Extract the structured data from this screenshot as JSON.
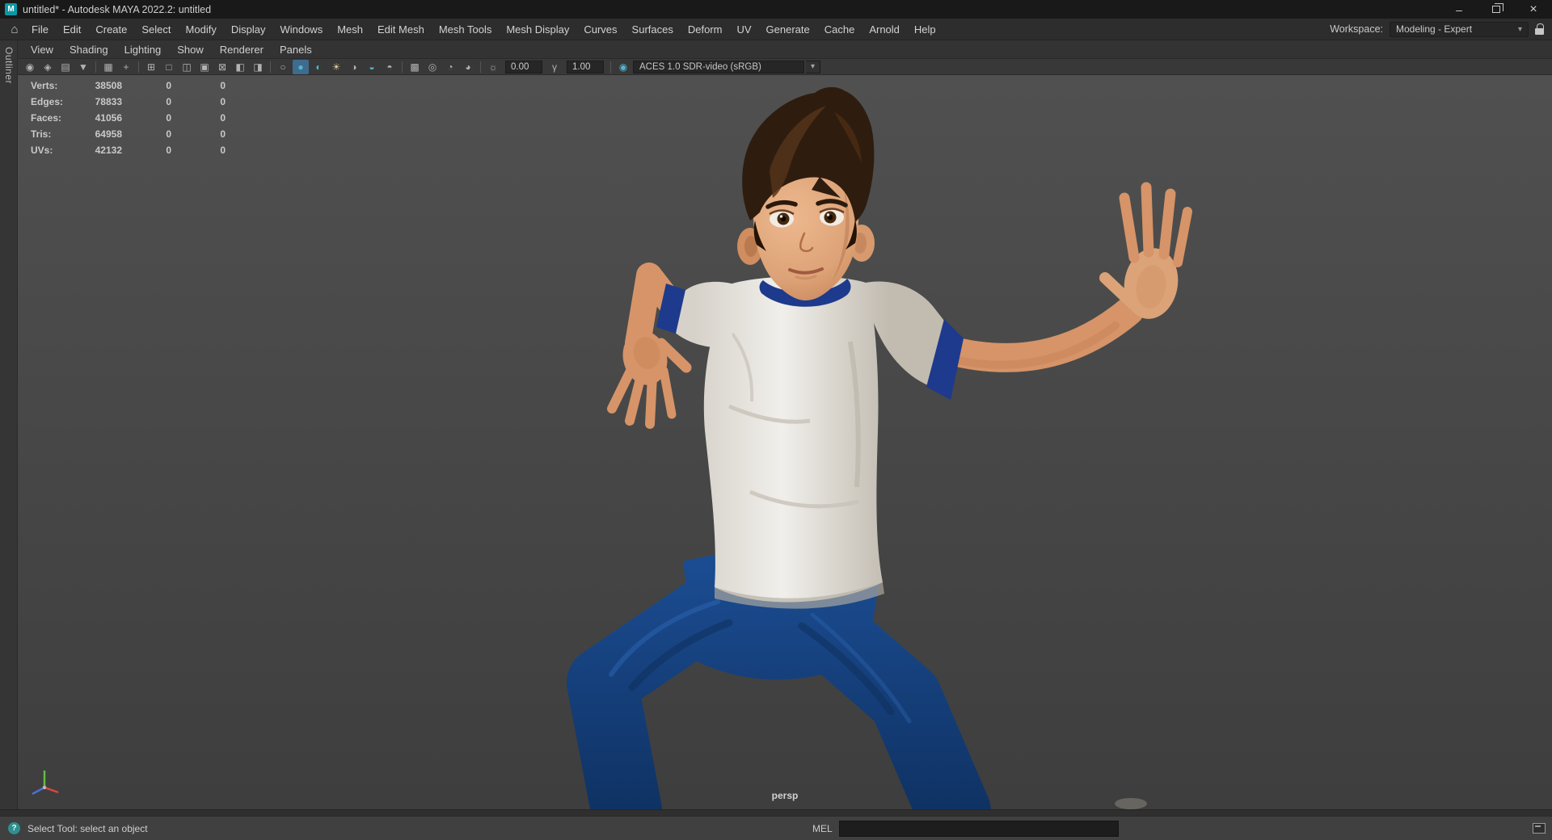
{
  "theme": {
    "accent_teal": "#0d97a5",
    "titlebar_bg": "#191919",
    "menubar_bg": "#2d2d2d",
    "viewport_top": "#505050",
    "viewport_bottom": "#3e3e3e",
    "shirt_white": "#f1efeb",
    "trim_navy": "#1d3a8c",
    "pants_blue": "#1c4e95",
    "skin_tone": "#d69468",
    "axis_x_color": "#d84a3a",
    "axis_y_color": "#5fbf3f",
    "axis_z_color": "#4a6fd8"
  },
  "window": {
    "logo_letter": "M",
    "title": "untitled* - Autodesk MAYA 2022.2: untitled",
    "minimize_glyph": "–",
    "close_glyph": "×"
  },
  "menubar": {
    "home_glyph": "⌂",
    "items": [
      "File",
      "Edit",
      "Create",
      "Select",
      "Modify",
      "Display",
      "Windows",
      "Mesh",
      "Edit Mesh",
      "Mesh Tools",
      "Mesh Display",
      "Curves",
      "Surfaces",
      "Deform",
      "UV",
      "Generate",
      "Cache",
      "Arnold",
      "Help"
    ],
    "workspace_label": "Workspace:",
    "workspace_value": "Modeling - Expert",
    "dropdown_glyph": "▾"
  },
  "panel_menubar": {
    "items": [
      "View",
      "Shading",
      "Lighting",
      "Show",
      "Renderer",
      "Panels"
    ]
  },
  "panel_toolbar": {
    "icons": [
      {
        "name": "select-camera",
        "glyph": "◉"
      },
      {
        "name": "lock-camera",
        "glyph": "◈"
      },
      {
        "name": "camera-attributes",
        "glyph": "▤"
      },
      {
        "name": "bookmarks",
        "glyph": "▼"
      },
      {
        "name": "image-plane",
        "glyph": "▦"
      },
      {
        "name": "pan-zoom",
        "glyph": "+"
      },
      {
        "name": "grid",
        "glyph": "⊞"
      },
      {
        "name": "film-gate",
        "glyph": "□"
      },
      {
        "name": "resolution-gate",
        "glyph": "◫"
      },
      {
        "name": "gate-mask",
        "glyph": "▣"
      },
      {
        "name": "field-chart",
        "glyph": "⊠"
      },
      {
        "name": "safe-action",
        "glyph": "◧"
      },
      {
        "name": "safe-title",
        "glyph": "◨"
      },
      {
        "name": "wireframe",
        "glyph": "○"
      },
      {
        "name": "shaded",
        "glyph": "●"
      },
      {
        "name": "textured",
        "glyph": "◐"
      },
      {
        "name": "use-all-lights",
        "glyph": "☀"
      },
      {
        "name": "shadows",
        "glyph": "◑"
      },
      {
        "name": "screen-space-ao",
        "glyph": "◒"
      },
      {
        "name": "motion-blur",
        "glyph": "◓"
      },
      {
        "name": "isolate-select",
        "glyph": "▩"
      },
      {
        "name": "xray",
        "glyph": "◎"
      },
      {
        "name": "wireframe-on-shaded",
        "glyph": "◔"
      },
      {
        "name": "default-material",
        "glyph": "◕"
      }
    ],
    "exposure_icon": "☼",
    "exposure_value": "0.00",
    "gamma_icon": "γ",
    "gamma_value": "1.00",
    "colorspace_icon": "◉",
    "colorspace_value": "ACES 1.0 SDR-video (sRGB)",
    "dropdown_glyph": "▾"
  },
  "left_tab": {
    "label": "Outliner"
  },
  "hud": {
    "rows": [
      {
        "label": "Verts:",
        "total": "38508",
        "col2": "0",
        "col3": "0"
      },
      {
        "label": "Edges:",
        "total": "78833",
        "col2": "0",
        "col3": "0"
      },
      {
        "label": "Faces:",
        "total": "41056",
        "col2": "0",
        "col3": "0"
      },
      {
        "label": "Tris:",
        "total": "64958",
        "col2": "0",
        "col3": "0"
      },
      {
        "label": "UVs:",
        "total": "42132",
        "col2": "0",
        "col3": "0"
      }
    ]
  },
  "viewport": {
    "camera_label": "persp"
  },
  "helpline": {
    "help_icon_glyph": "?",
    "text": "Select Tool: select an object",
    "mel_label": "MEL",
    "mel_value": ""
  }
}
